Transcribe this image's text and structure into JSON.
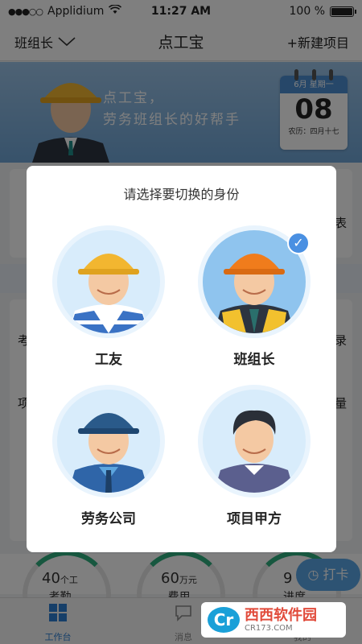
{
  "status_bar": {
    "carrier": "Applidium",
    "time": "11:27 AM",
    "battery": "100 %"
  },
  "nav": {
    "role": "班组长",
    "title": "点工宝",
    "new_project": "+新建项目"
  },
  "banner": {
    "slogan_line1": "点工宝，",
    "slogan_line2": "劳务班组长的好帮手",
    "calendar": {
      "header": "6月 星期一",
      "day": "08",
      "lunar": "农历：四月十七"
    }
  },
  "background": {
    "partial_texts": [
      "表",
      "考",
      "录",
      "项",
      "量"
    ],
    "stats": [
      {
        "value": "40",
        "unit": "个工",
        "label": "考勤"
      },
      {
        "value": "60",
        "unit": "万元",
        "label": "费用"
      },
      {
        "value": "9",
        "unit": "",
        "label": "进度"
      }
    ],
    "punch_label": "打卡"
  },
  "tabbar": [
    {
      "label": "工作台",
      "icon": "grid-icon",
      "active": true
    },
    {
      "label": "消息",
      "icon": "chat-icon",
      "active": false
    },
    {
      "label": "我的",
      "icon": "user-icon",
      "active": false
    }
  ],
  "watermark": {
    "logo": "Cr",
    "name": "西西软件园",
    "site": "CR173.COM"
  },
  "dialog": {
    "title": "请选择要切换的身份",
    "options": [
      {
        "label": "工友",
        "selected": false,
        "helmet_color": "#f2b630"
      },
      {
        "label": "班组长",
        "selected": true,
        "helmet_color": "#f07c1c"
      },
      {
        "label": "劳务公司",
        "selected": false,
        "helmet_color": "#2a5a8a"
      },
      {
        "label": "项目甲方",
        "selected": false,
        "helmet_color": ""
      }
    ]
  },
  "colors": {
    "accent": "#4a90e2",
    "tab_active": "#2d7fd3",
    "ring_progress": "#2fae7e"
  }
}
